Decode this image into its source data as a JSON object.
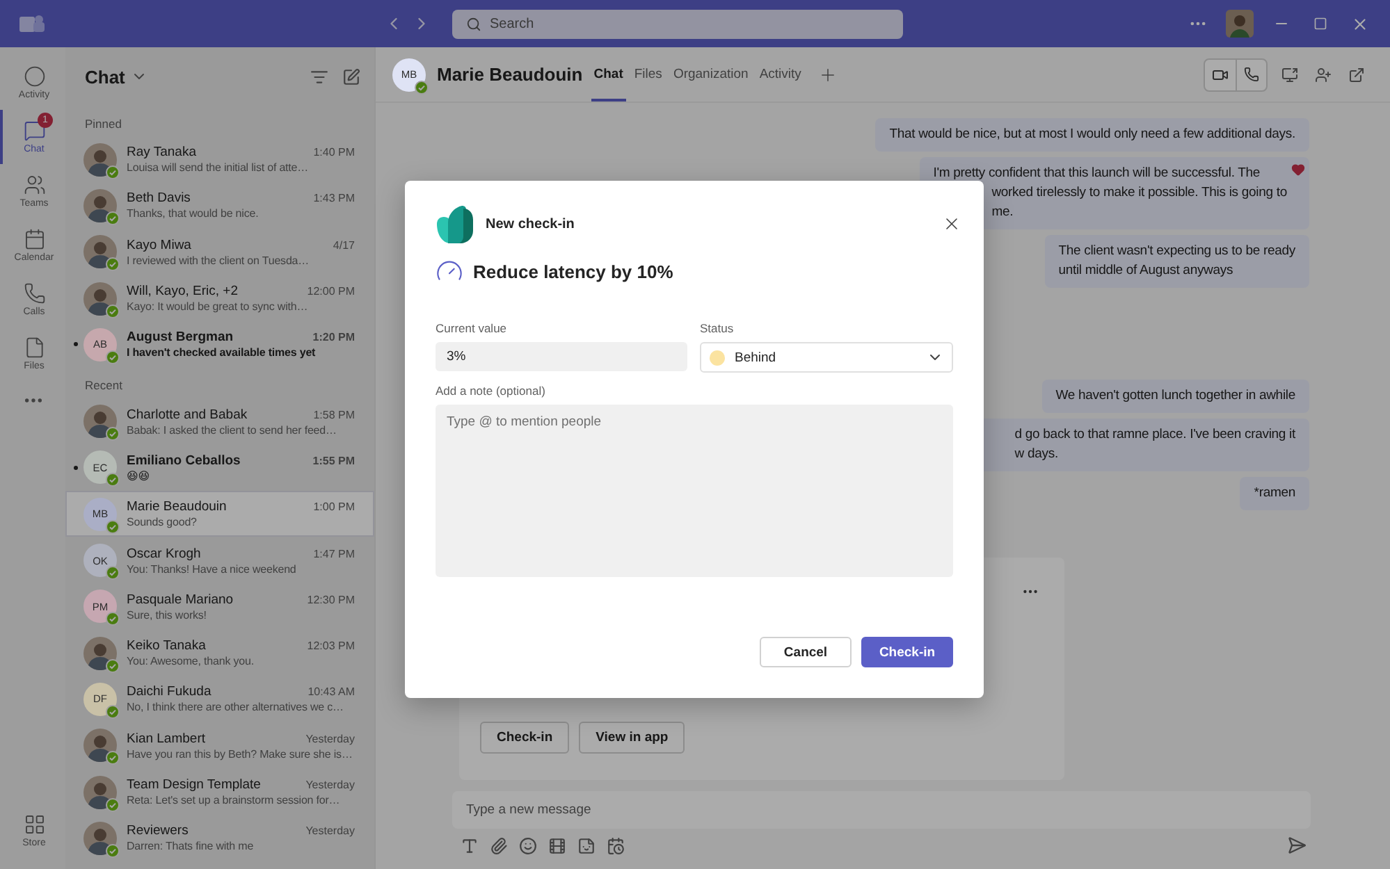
{
  "titlebar": {
    "search_placeholder": "Search"
  },
  "rail": {
    "items": [
      {
        "label": "Activity",
        "kind": "activity",
        "selected": false
      },
      {
        "label": "Chat",
        "kind": "chat",
        "selected": true,
        "badge": "1"
      },
      {
        "label": "Teams",
        "kind": "teams",
        "selected": false
      },
      {
        "label": "Calendar",
        "kind": "calendar",
        "selected": false
      },
      {
        "label": "Calls",
        "kind": "calls",
        "selected": false
      },
      {
        "label": "Files",
        "kind": "files",
        "selected": false
      }
    ],
    "store": "Store"
  },
  "chat_list": {
    "title": "Chat",
    "sections": [
      {
        "heading": "Pinned",
        "items": [
          {
            "name": "Ray Tanaka",
            "time": "1:40 PM",
            "preview": "Louisa will send the initial list of atte…",
            "avatar": {
              "kind": "photo"
            },
            "unread": false,
            "selected": false
          },
          {
            "name": "Beth Davis",
            "time": "1:43 PM",
            "preview": "Thanks, that would be nice.",
            "avatar": {
              "kind": "photo"
            },
            "unread": false,
            "selected": false
          },
          {
            "name": "Kayo Miwa",
            "time": "4/17",
            "preview": "I reviewed with the client on Tuesda…",
            "avatar": {
              "kind": "photo"
            },
            "unread": false,
            "selected": false
          },
          {
            "name": "Will, Kayo, Eric, +2",
            "time": "12:00 PM",
            "preview": "Kayo: It would be great to sync with…",
            "avatar": {
              "kind": "photo"
            },
            "unread": false,
            "selected": false
          },
          {
            "name": "August Bergman",
            "time": "1:20 PM",
            "preview": "I haven't checked available times yet",
            "avatar": {
              "kind": "initials",
              "initials": "AB",
              "color": "#c6a8ad"
            },
            "unread": true,
            "selected": false
          }
        ]
      },
      {
        "heading": "Recent",
        "items": [
          {
            "name": "Charlotte and Babak",
            "time": "1:58 PM",
            "preview": "Babak: I asked the client to send her feed…",
            "avatar": {
              "kind": "photo"
            },
            "unread": false,
            "selected": false
          },
          {
            "name": "Emiliano Ceballos",
            "time": "1:55 PM",
            "preview": "😆😆",
            "avatar": {
              "kind": "initials",
              "initials": "EC",
              "color": "#b5bbb5"
            },
            "unread": true,
            "selected": false
          },
          {
            "name": "Marie Beaudouin",
            "time": "1:00 PM",
            "preview": "Sounds good?",
            "avatar": {
              "kind": "initials",
              "initials": "MB",
              "color": "#aaaec6"
            },
            "unread": false,
            "selected": true
          },
          {
            "name": "Oscar Krogh",
            "time": "1:47 PM",
            "preview": "You: Thanks! Have a nice weekend",
            "avatar": {
              "kind": "initials",
              "initials": "OK",
              "color": "#aeb1bd"
            },
            "unread": false,
            "selected": false
          },
          {
            "name": "Pasquale Mariano",
            "time": "12:30 PM",
            "preview": "Sure, this works!",
            "avatar": {
              "kind": "initials",
              "initials": "PM",
              "color": "#c6a7b1"
            },
            "unread": false,
            "selected": false
          },
          {
            "name": "Keiko Tanaka",
            "time": "12:03 PM",
            "preview": "You: Awesome, thank you.",
            "avatar": {
              "kind": "photo"
            },
            "unread": false,
            "selected": false
          },
          {
            "name": "Daichi Fukuda",
            "time": "10:43 AM",
            "preview": "No, I think there are other alternatives we c…",
            "avatar": {
              "kind": "initials",
              "initials": "DF",
              "color": "#c9c1a7"
            },
            "unread": false,
            "selected": false
          },
          {
            "name": "Kian Lambert",
            "time": "Yesterday",
            "preview": "Have you ran this by Beth? Make sure she is…",
            "avatar": {
              "kind": "photo"
            },
            "unread": false,
            "selected": false
          },
          {
            "name": "Team Design Template",
            "time": "Yesterday",
            "preview": "Reta: Let's set up a brainstorm session for…",
            "avatar": {
              "kind": "photo"
            },
            "unread": false,
            "selected": false
          },
          {
            "name": "Reviewers",
            "time": "Yesterday",
            "preview": "Darren: Thats fine with me",
            "avatar": {
              "kind": "photo"
            },
            "unread": false,
            "selected": false
          }
        ]
      }
    ]
  },
  "conversation": {
    "initials": "MB",
    "name": "Marie Beaudouin",
    "tabs": [
      {
        "label": "Chat",
        "selected": true
      },
      {
        "label": "Files",
        "selected": false
      },
      {
        "label": "Organization",
        "selected": false
      },
      {
        "label": "Activity",
        "selected": false
      }
    ],
    "messages": [
      {
        "lines": [
          {
            "text": "That would be nice, but at most I would only need a few additional days.",
            "cut": false
          }
        ]
      },
      {
        "lines": [
          {
            "text": "I'm pretty confident that this launch will be successful. The",
            "cut": false
          },
          {
            "text": "worked tirelessly to make it possible. This is going to",
            "cut": true
          },
          {
            "text": "me.",
            "cut": true
          }
        ],
        "reactions": [
          {
            "kind": "heart"
          }
        ]
      },
      {
        "lines": [
          {
            "text": "The client wasn't expecting us to be ready",
            "cut": false
          },
          {
            "text": "until middle of August anyways",
            "cut": false
          }
        ]
      }
    ],
    "later_messages": [
      {
        "lines": [
          {
            "text": "We haven't gotten lunch together in awhile",
            "cut": false
          }
        ]
      },
      {
        "lines": [
          {
            "text": "d go back to that ramne place. I've been craving it",
            "cut": true
          },
          {
            "text": "w days.",
            "cut": true
          }
        ]
      },
      {
        "lines": [
          {
            "text": "*ramen",
            "cut": false
          }
        ]
      }
    ],
    "card": {
      "buttons": [
        "Check-in",
        "View in app"
      ]
    },
    "compose": {
      "placeholder": "Type a new message"
    }
  },
  "dialog": {
    "title": "New check-in",
    "goal": "Reduce latency by 10%",
    "current_value": {
      "label": "Current value",
      "value": "3%"
    },
    "status": {
      "label": "Status",
      "value": "Behind",
      "kind": "behind"
    },
    "note": {
      "label": "Add a note (optional)",
      "placeholder": "Type @ to mention people"
    },
    "buttons": [
      {
        "label": "Cancel",
        "kind": "secondary"
      },
      {
        "label": "Check-in",
        "kind": "primary"
      }
    ]
  }
}
